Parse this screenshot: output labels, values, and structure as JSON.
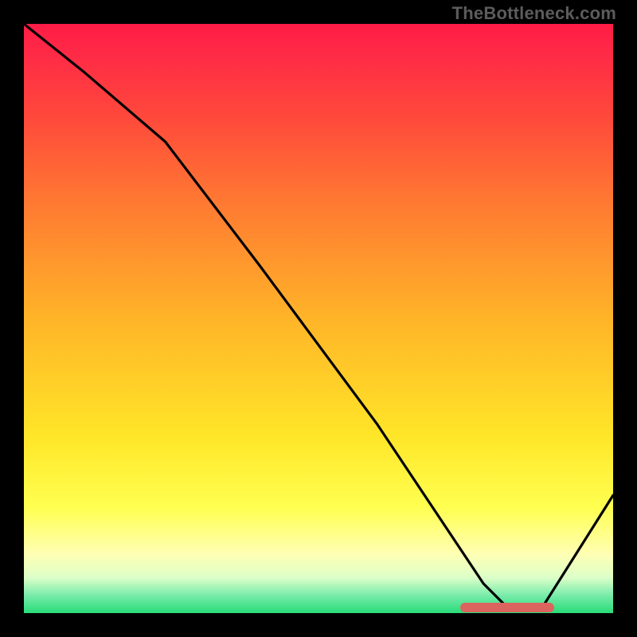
{
  "watermark": "TheBottleneck.com",
  "chart_data": {
    "type": "line",
    "title": "",
    "xlabel": "",
    "ylabel": "",
    "xlim": [
      0,
      100
    ],
    "ylim": [
      0,
      100
    ],
    "series": [
      {
        "name": "curve",
        "x": [
          0,
          10,
          24,
          40,
          60,
          78,
          82,
          88,
          100
        ],
        "values": [
          100,
          92,
          80,
          59,
          32,
          5,
          1,
          1,
          20
        ]
      }
    ],
    "marker_band": {
      "x_start": 74,
      "x_end": 90,
      "y": 1
    },
    "background_gradient": {
      "top": "#ff1c46",
      "upper_mid": "#ff8a2c",
      "lower_mid": "#ffee30",
      "near_bottom": "#ffffc0",
      "bottom": "#28dc78"
    }
  }
}
